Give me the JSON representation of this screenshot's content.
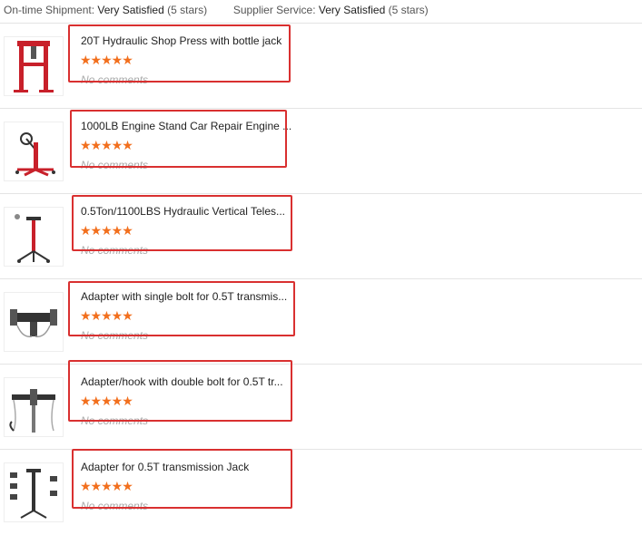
{
  "seller_ratings": {
    "shipment_label": "On-time Shipment:",
    "shipment_value": "Very Satisfied",
    "shipment_stars": "(5 stars)",
    "service_label": "Supplier Service:",
    "service_value": "Very Satisfied",
    "service_stars": "(5 stars)"
  },
  "items": [
    {
      "title": "20T Hydraulic Shop Press with bottle jack",
      "rating": "★★★★★",
      "comment": "No comments"
    },
    {
      "title": "1000LB Engine Stand Car Repair Engine ...",
      "rating": "★★★★★",
      "comment": "No comments"
    },
    {
      "title": "0.5Ton/1100LBS Hydraulic Vertical Teles...",
      "rating": "★★★★★",
      "comment": "No comments"
    },
    {
      "title": "Adapter with single bolt for 0.5T transmis...",
      "rating": "★★★★★",
      "comment": "No comments"
    },
    {
      "title": "Adapter/hook with double bolt for 0.5T tr...",
      "rating": "★★★★★",
      "comment": "No comments"
    },
    {
      "title": "Adapter for 0.5T transmission Jack",
      "rating": "★★★★★",
      "comment": "No comments"
    }
  ],
  "colors": {
    "star": "#f26f1d",
    "highlight": "#d93030",
    "product_red": "#c8202a"
  }
}
